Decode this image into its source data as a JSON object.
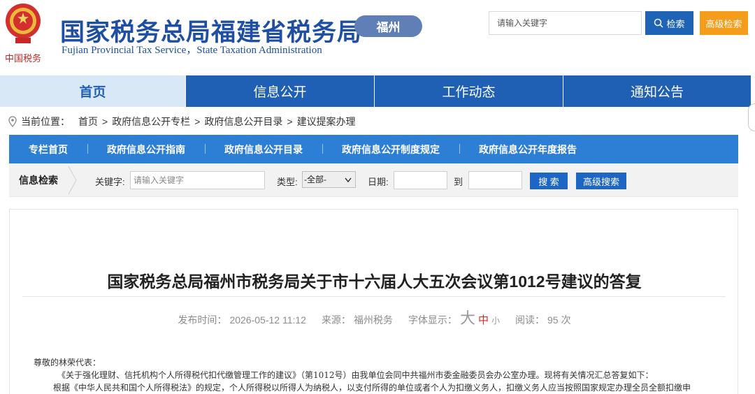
{
  "header": {
    "title_cn": "国家税务总局福建省税务局",
    "title_en": "Fujian Provincial Tax Service，State Taxation Administration",
    "logo_text": "中国税务",
    "city": "福州",
    "search_placeholder": "请输入关键字",
    "search_button": "检索",
    "advanced_button": "高级检索"
  },
  "mainnav": {
    "items": [
      {
        "label": "首页"
      },
      {
        "label": "信息公开"
      },
      {
        "label": "工作动态"
      },
      {
        "label": "通知公告"
      }
    ]
  },
  "breadcrumb": {
    "prefix": "当前位置：",
    "items": [
      "首页",
      "政府信息公开专栏",
      "政府信息公开目录",
      "建议提案办理"
    ],
    "separator": ">"
  },
  "subnav": {
    "items": [
      "专栏首页",
      "政府信息公开指南",
      "政府信息公开目录",
      "政府信息公开制度规定",
      "政府信息公开年度报告"
    ]
  },
  "filter": {
    "label": "信息检索",
    "keyword_label": "关键字:",
    "keyword_placeholder": "请输入关键字",
    "type_label": "类型:",
    "type_value": "-全部-",
    "date_label": "日期:",
    "to_label": "到",
    "search_button": "搜 索",
    "advanced_button": "高级搜索"
  },
  "article": {
    "title": "国家税务总局福州市税务局关于市十六届人大五次会议第1012号建议的答复",
    "publish_label": "发布时间：",
    "publish_time": "2026-05-12 11:12",
    "source_label": "来源：",
    "source": "福州税务",
    "font_label": "字体显示：",
    "font_big": "大",
    "font_mid": "中",
    "font_small": "小",
    "read_label": "阅读：",
    "read_count": "95",
    "read_unit": "次",
    "body": [
      "尊敬的林荣代表：",
      "《关于强化理财、信托机构个人所得税代扣代缴管理工作的建议》（第1012号）由我单位会同中共福州市委金融委员会办公室办理。现将有关情况汇总答复如下：",
      "根据《中华人民共和国个人所得税法》的规定，个人所得税以所得人为纳税人，以支付所得的单位或者个人为扣缴义务人，扣缴义务人应当按照国家规定办理全员全额扣缴申"
    ]
  },
  "colors": {
    "brand_blue": "#1e4fa3",
    "nav_blue": "#1f5fb4",
    "subnav_blue": "#2d7fd5",
    "accent_orange": "#f59c1a",
    "badge_blue": "#5f7fb6"
  }
}
